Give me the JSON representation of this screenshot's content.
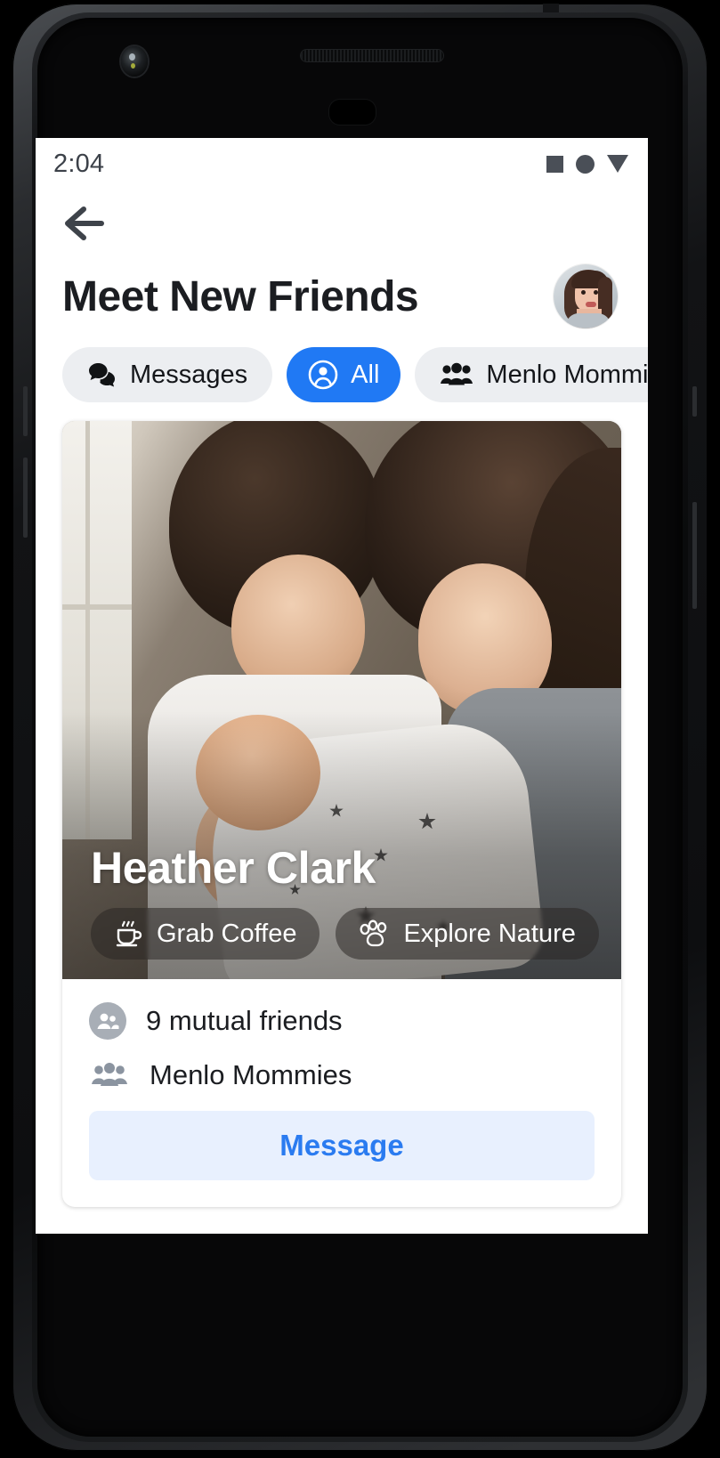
{
  "statusbar": {
    "time": "2:04",
    "icons": [
      "square-icon",
      "circle-icon",
      "triangle-icon"
    ]
  },
  "header": {
    "back_icon": "back-arrow-icon",
    "title": "Meet New Friends",
    "avatar_alt": "user-avatar"
  },
  "filters": {
    "chips": [
      {
        "label": "Messages",
        "icon": "chat-bubbles-icon",
        "active": false
      },
      {
        "label": "All",
        "icon": "person-circle-icon",
        "active": true
      },
      {
        "label": "Menlo Mommies",
        "icon": "group-people-icon",
        "active": false
      }
    ]
  },
  "profile_card": {
    "name": "Heather Clark",
    "tags": [
      {
        "label": "Grab Coffee",
        "icon": "coffee-cup-icon"
      },
      {
        "label": "Explore Nature",
        "icon": "paw-print-icon"
      }
    ],
    "info": [
      {
        "label": "9 mutual friends",
        "icon": "mutual-friends-icon"
      },
      {
        "label": "Menlo Mommies",
        "icon": "group-people-icon"
      }
    ],
    "message_button": "Message"
  },
  "colors": {
    "accent_blue": "#2079f4",
    "message_text": "#2a7bf0",
    "message_bg": "#e8f0fe",
    "chip_bg": "#eceef1",
    "text_primary": "#1b1d21"
  }
}
